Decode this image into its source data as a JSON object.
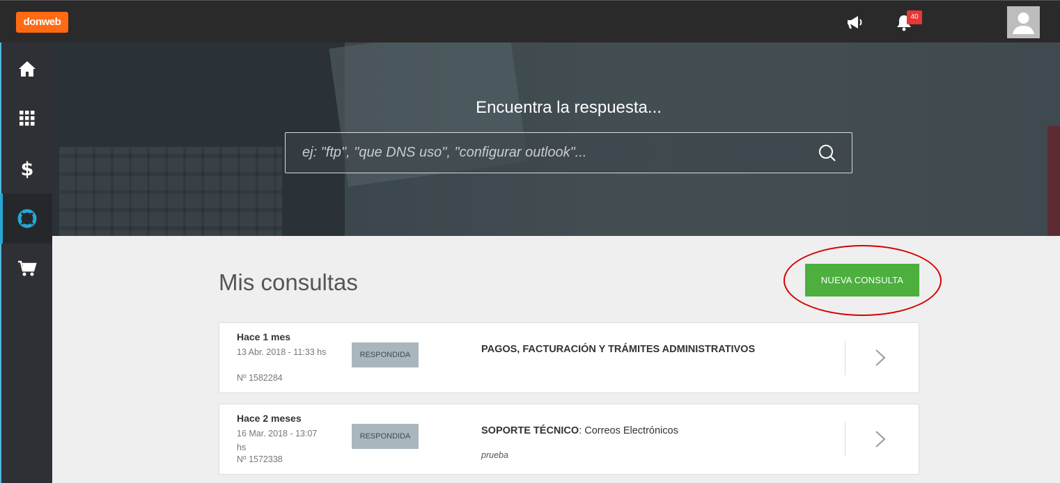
{
  "brand": {
    "logo_text": "donweb",
    "color": "#ff6a13"
  },
  "topbar": {
    "icons": [
      "megaphone-icon",
      "bell-icon",
      "user-avatar-icon"
    ],
    "notifications_count": "40"
  },
  "sidebar": {
    "items": [
      {
        "name": "home",
        "icon": "home-icon"
      },
      {
        "name": "apps",
        "icon": "grid-icon"
      },
      {
        "name": "billing",
        "icon": "dollar-icon"
      },
      {
        "name": "support",
        "icon": "lifebuoy-icon",
        "active": true
      },
      {
        "name": "shop",
        "icon": "cart-icon"
      }
    ]
  },
  "hero": {
    "title": "Encuentra la respuesta...",
    "search_placeholder": "ej: \"ftp\", \"que DNS uso\", \"configurar outlook\"..."
  },
  "main": {
    "title": "Mis consultas",
    "new_button": "NUEVA CONSULTA",
    "accent": "#4caf3e",
    "tickets": [
      {
        "when": "Hace 1 mes",
        "date": "13 Abr. 2018 - 11:33 hs",
        "number": "Nº 1582284",
        "status": "RESPONDIDA",
        "category": "PAGOS, FACTURACIÓN Y TRÁMITES ADMINISTRATIVOS",
        "subcategory": "",
        "note": ""
      },
      {
        "when": "Hace 2 meses",
        "date": "16 Mar. 2018 - 13:07 hs",
        "number": "Nº 1572338",
        "status": "RESPONDIDA",
        "category": "SOPORTE TÉCNICO",
        "subcategory": ": Correos Electrónicos",
        "note": "prueba"
      }
    ]
  }
}
